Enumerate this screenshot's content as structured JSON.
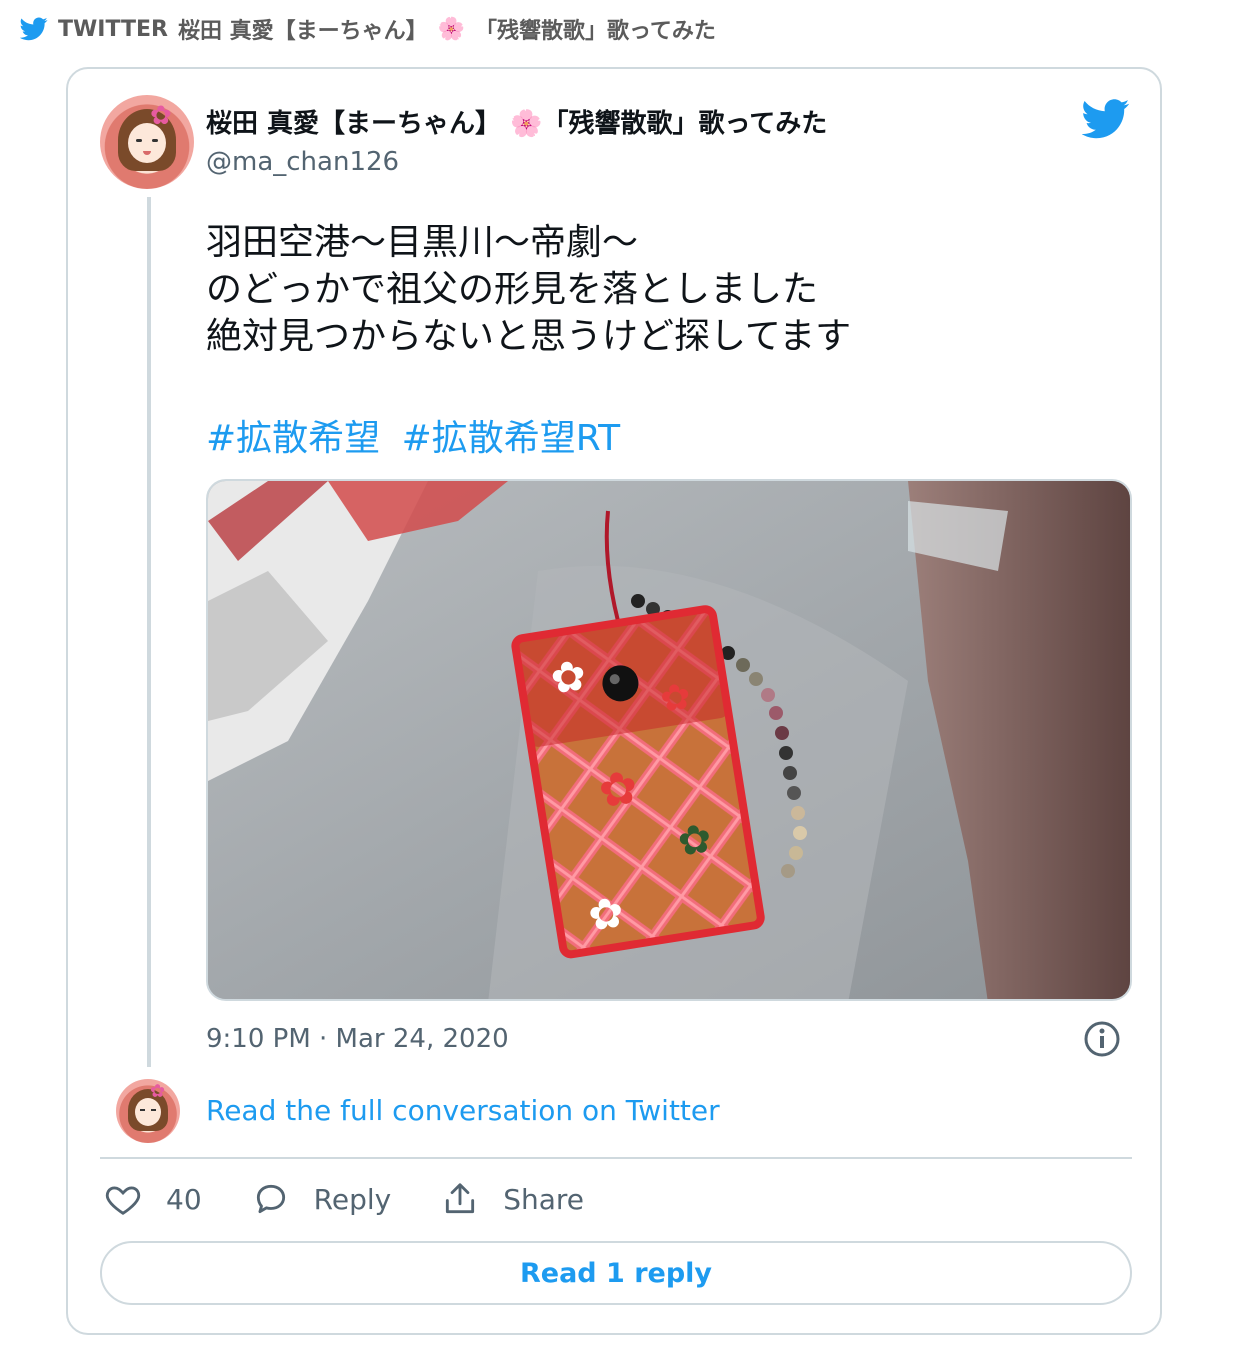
{
  "header": {
    "source_label": "TWITTER",
    "title": "桜田 真愛【まーちゃん】",
    "title_suffix": "「残響散歌」歌ってみた",
    "emoji": "🌸"
  },
  "tweet": {
    "author_name": "桜田 真愛【まーちゃん】",
    "author_name_suffix": "「残響散歌」歌ってみた",
    "author_emoji": "🌸",
    "handle": "@ma_chan126",
    "lines": [
      "羽田空港〜目黒川〜帝劇〜",
      "のどっかで祖父の形見を落としました",
      "絶対見つからないと思うけど探してます"
    ],
    "hashtags": [
      "#拡散希望",
      "#拡散希望RT"
    ],
    "timestamp": "9:10 PM · Mar 24, 2020"
  },
  "read_conversation": "Read the full conversation on Twitter",
  "actions": {
    "likes": "40",
    "reply_label": "Reply",
    "share_label": "Share"
  },
  "read_reply_button": "Read 1 reply",
  "colors": {
    "accent": "#1d9bf0",
    "text": "#0f1419",
    "secondary": "#536471",
    "border": "#cfd9de"
  },
  "icons": {
    "header_logo": "twitter-bird-icon",
    "card_logo": "twitter-bird-icon",
    "info": "info-icon",
    "like": "heart-icon",
    "reply": "speech-bubble-icon",
    "share": "share-icon"
  }
}
